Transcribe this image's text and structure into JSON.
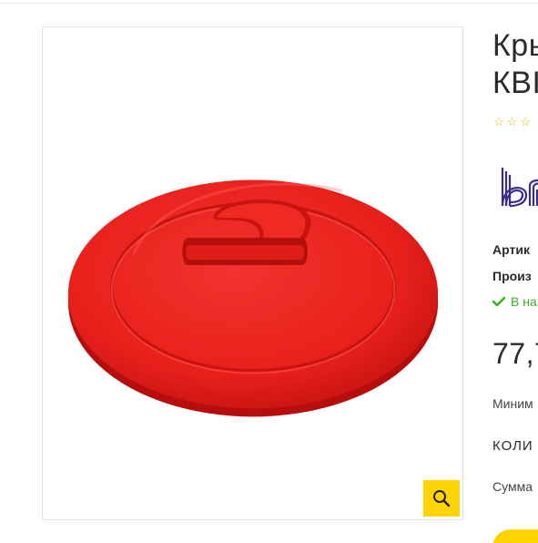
{
  "product": {
    "title": "Кры\nКВІ",
    "rating_stars": [
      "☆",
      "☆",
      "☆"
    ],
    "sku_label": "Артик",
    "manufacturer_label": "Произ",
    "stock_status": "В на",
    "price": "77,7",
    "minimum_label": "Миним",
    "quantity_label": "КОЛИ",
    "sum_label": "Сумма"
  },
  "colors": {
    "accent": "#ffd400",
    "lid_red": "#e8201c",
    "stock_green": "#3fae29",
    "brand_purple": "#3d2a8f"
  },
  "icons": {
    "zoom": "search-icon",
    "stock": "check-icon",
    "brand": "brand-logo"
  }
}
